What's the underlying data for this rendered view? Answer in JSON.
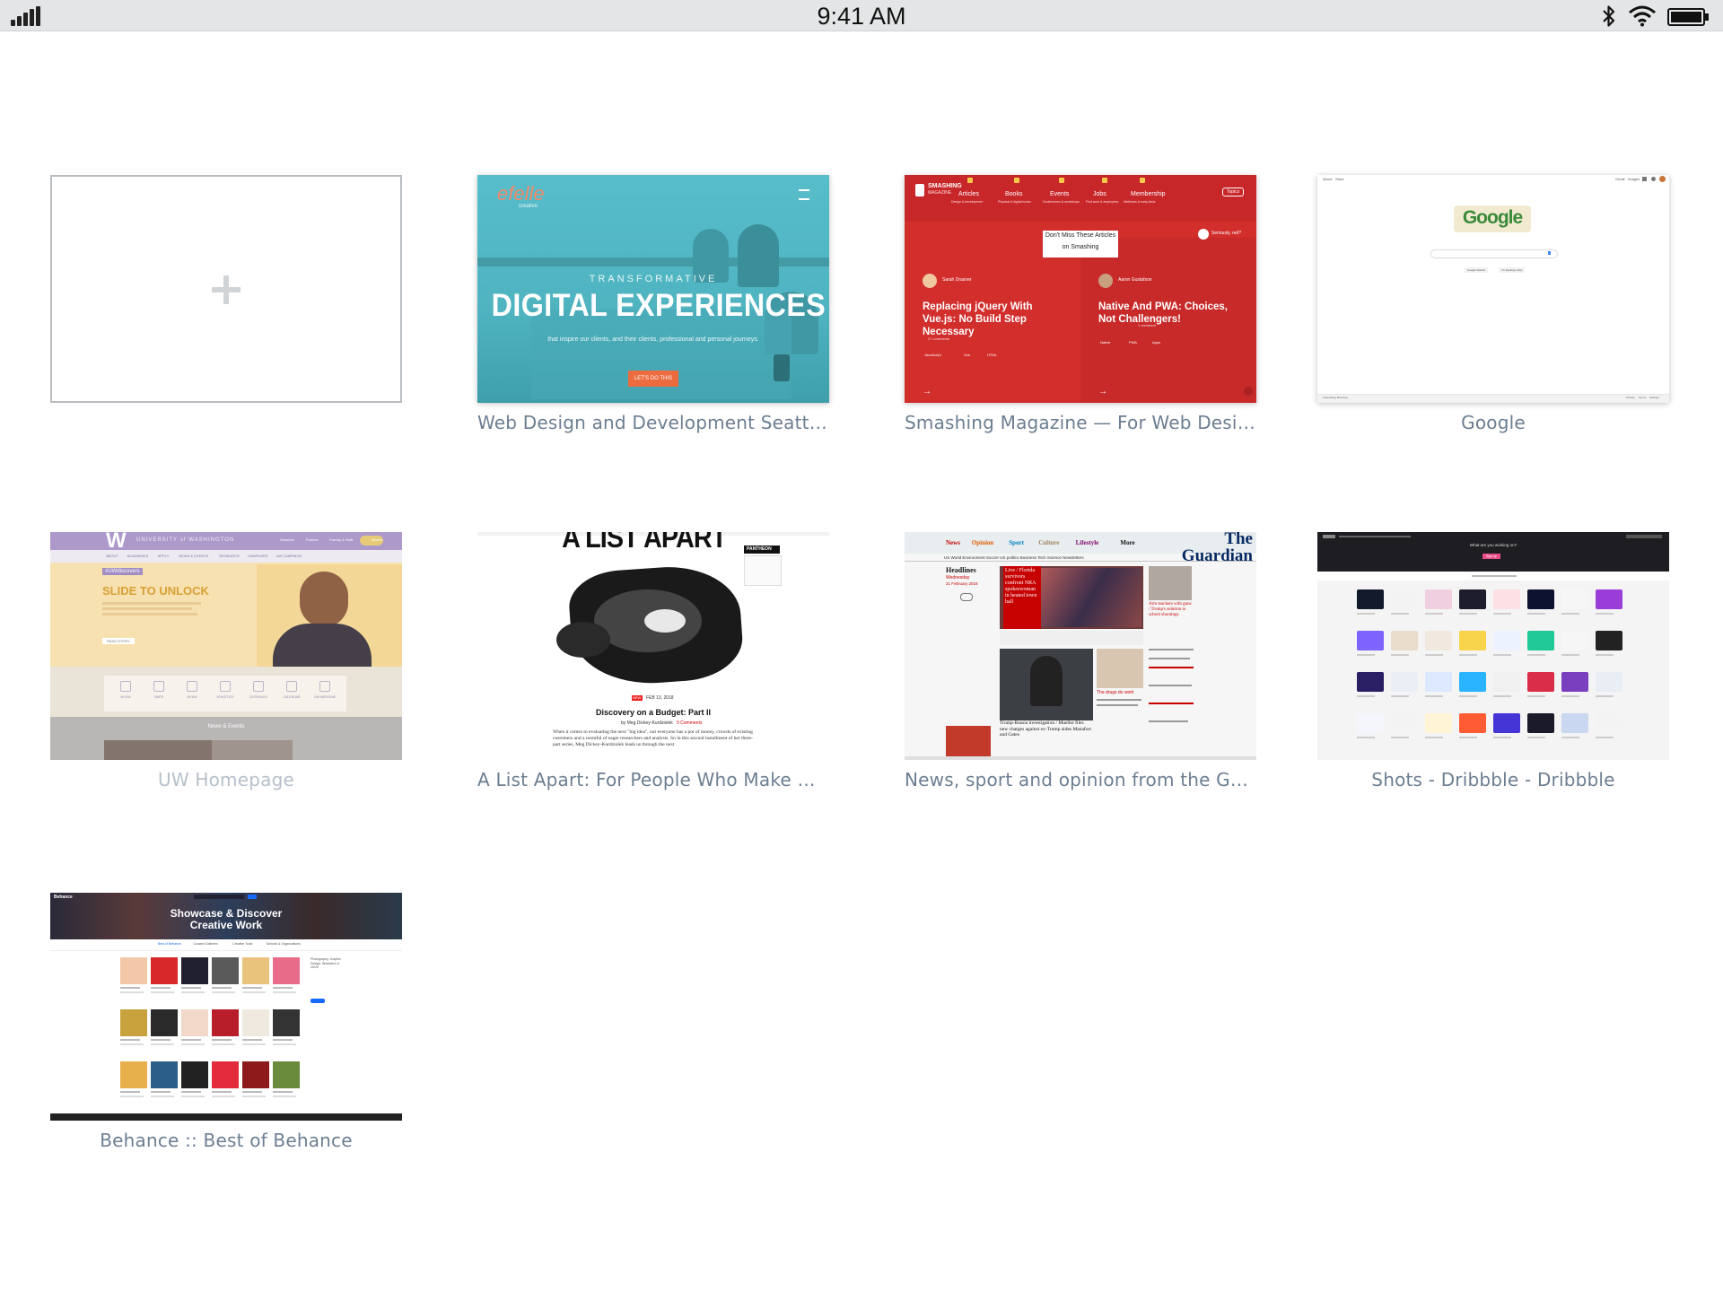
{
  "status_bar": {
    "time": "9:41 AM",
    "icons": [
      "signal-icon",
      "bluetooth-icon",
      "wifi-icon",
      "battery-icon"
    ]
  },
  "new_tab": {
    "icon": "plus-icon"
  },
  "tiles": [
    {
      "caption": "Web Design and Development Seattle : ...",
      "thumb": {
        "logo": "efelle",
        "logo_sub": "creative",
        "eyebrow": "TRANSFORMATIVE",
        "headline": "DIGITAL EXPERIENCES",
        "subline": "that inspire our clients, and their clients, professional and personal journeys.",
        "cta": "LET'S DO THIS",
        "accent": "#5dc3cf"
      }
    },
    {
      "caption": "Smashing Magazine — For Web Designe...",
      "thumb": {
        "brand": "SMASHING",
        "brand_sub": "MAGAZINE",
        "nav": [
          {
            "label": "Articles",
            "sub": "Design & development"
          },
          {
            "label": "Books",
            "sub": "Physical & digital books"
          },
          {
            "label": "Events",
            "sub": "Conferences & workshops"
          },
          {
            "label": "Jobs",
            "sub": "Find work & employees"
          },
          {
            "label": "Membership",
            "sub": "Webinars & early-birds"
          }
        ],
        "topics": "Topics",
        "banner": "Don't Miss These Articles",
        "banner2": "on Smashing",
        "seriously": "Seriously, red?",
        "articles": [
          {
            "author": "Sarah Drasner",
            "title": "Replacing jQuery With Vue.js: No Build Step Necessary",
            "meta": "27 comments",
            "tags": [
              "JavaScript",
              "Vue",
              "HTML"
            ]
          },
          {
            "author": "Aaron Gustafson",
            "title": "Native And PWA: Choices, Not Challengers!",
            "meta": "1 comment",
            "tags": [
              "Native",
              "PWA",
              "Apps"
            ]
          }
        ],
        "accent": "#d12e2c"
      }
    },
    {
      "caption": "Google",
      "thumb": {
        "doodle": "Google",
        "btn1": "Google Search",
        "btn2": "I'm Feeling Lucky",
        "top_left": [
          "About",
          "Store"
        ],
        "top_right": [
          "Gmail",
          "Images"
        ],
        "footer_left": [
          "Advertising",
          "Business"
        ],
        "footer_right": [
          "Privacy",
          "Terms",
          "Settings"
        ]
      }
    },
    {
      "caption": "UW Homepage",
      "thumb": {
        "logo": "W",
        "university": "UNIVERSITY of WASHINGTON",
        "top_links": [
          "Students",
          "Parents",
          "Faculty & Staff",
          "Alumni"
        ],
        "nav": [
          "ABOUT",
          "ACADEMICS",
          "APPLY",
          "NEWS & EVENTS",
          "RESEARCH",
          "CAMPUSES",
          "UW CAMPAIGN"
        ],
        "tag": "#UWdiscovers",
        "headline": "SLIDE TO UNLOCK",
        "cta": "READ STORY",
        "icons": [
          "MYUW",
          "MAPS",
          "MYUW",
          "ATHLETICS",
          "OUTREACH",
          "CALENDAR",
          "UW MEDICINE"
        ],
        "news": "News & Events"
      }
    },
    {
      "caption": "A List Apart: For People Who Make Webs...",
      "thumb": {
        "masthead": "A LIST APART",
        "sponsor": "PANTHEON",
        "badge": "NEW",
        "date": "FEB 13, 2018",
        "title": "Discovery on a Budget: Part II",
        "byline": "by Meg Dickey-Kurdziolek",
        "comments": "9 Comments",
        "body": "When it comes to evaluating the next \"big idea\", not everyone has a pot of money, crowds of existing customers and a roomful of eager researchers and analysts. So in this second installment of her three-part series, Meg Dickey-Kurdziolek leads us through the next"
      }
    },
    {
      "caption": "News, sport and opinion from the Guar...",
      "thumb": {
        "masthead": "The Guardian",
        "nav": [
          "News",
          "Opinion",
          "Sport",
          "Culture",
          "Lifestyle",
          "More"
        ],
        "subnav": "US World Environment Soccer US politics Business Tech Science Newsletters",
        "section": "Headlines",
        "day": "Wednesday",
        "date": "21 February 2018",
        "lead": "Live / Florida survivors confront NRA spokeswoman in heated town hall",
        "story2": "Trump-Russia investigation / Mueller files new charges against ex-Trump aides Manafort and Gates",
        "story3": "Arm teachers with guns / Trump's solution to school shootings",
        "story4": "The drugs do work",
        "red": "#c70000"
      }
    },
    {
      "caption": "Shots - Dribbble - Dribbble",
      "thumb": {
        "prompt": "What are you working on?",
        "signup": "Sign up",
        "swatches": [
          [
            "#121a2b",
            "#f3f3f3",
            "#f0d0e0",
            "#1d1d2e",
            "#fde0e6",
            "#0c1230",
            "#f6f6f6",
            "#9a3dd8"
          ],
          [
            "#7e63ff",
            "#e9dccb",
            "#f1e9df",
            "#f7d44c",
            "#ecf3ff",
            "#20c997",
            "#f6f6f6",
            "#222"
          ],
          [
            "#2a1e64",
            "#eaeef5",
            "#dce9ff",
            "#2ab3ff",
            "#f0f0f0",
            "#d92d4a",
            "#7a3fbf",
            "#e9eef5"
          ],
          [
            "#f4f6fb",
            "#f3f3f3",
            "#fff4d6",
            "#ff5b35",
            "#4534d6",
            "#1a1a2a",
            "#c9d7f0",
            "#f3f3f3"
          ]
        ]
      }
    },
    {
      "caption": "Behance :: Best of Behance",
      "thumb": {
        "brand": "Behance",
        "hero": "Showcase & Discover",
        "hero2": "Creative Work",
        "tabs": [
          "Best of Behance",
          "Curated Galleries",
          "Creative Tools",
          "Schools & Organizations"
        ],
        "side": "Photography, Graphic Design, Illustration & UI/UX",
        "swatches": [
          [
            "#f2c8a8",
            "#d8282a",
            "#1f1f2e",
            "#5a5a5a",
            "#e9c27b",
            "#e86c8a"
          ],
          [
            "#c8a23c",
            "#2a2a2a",
            "#f2d8c8",
            "#b81e2a",
            "#efe9e0",
            "#333"
          ],
          [
            "#e8b04c",
            "#2b5f8a",
            "#222",
            "#e42b3c",
            "#8c1a1a",
            "#6a8a3c"
          ]
        ]
      }
    }
  ]
}
